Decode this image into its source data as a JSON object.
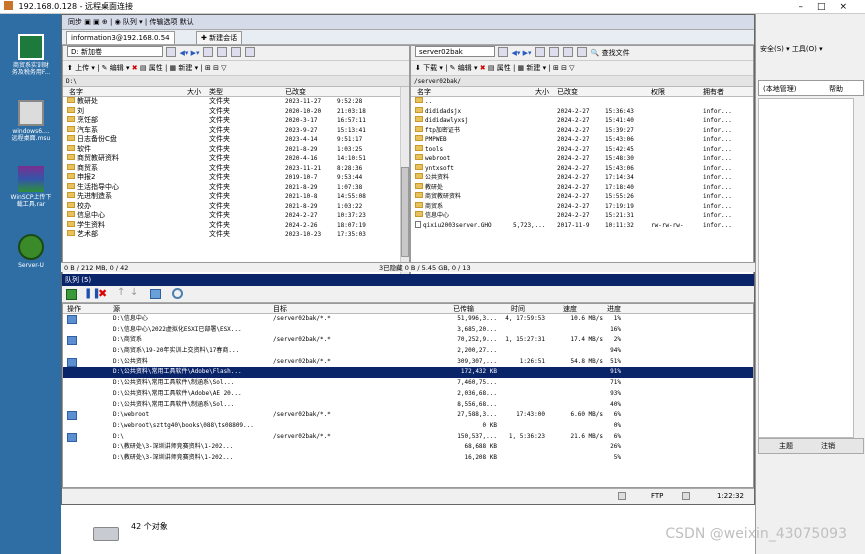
{
  "rdp": {
    "title": "192.168.0.128 - 远程桌面连接"
  },
  "desktop_icons": [
    {
      "label": "商贸系实训财\n务及税务用F..."
    },
    {
      "label": "windows6....\n远程桌面.msu"
    },
    {
      "label": "WinSCP上传下\n载工具.rar"
    },
    {
      "label": "Server-U"
    }
  ],
  "bgwin": {
    "menu": "安全(S) ▾  工具(O) ▾",
    "tab": "(本地管理)",
    "help": "帮助",
    "theme": "主题",
    "logout": "注销"
  },
  "winscp": {
    "toolbar_top": "同步   ▣  ▣  ⊕  | ◉ 队列 ▾ |  传输选项  默认",
    "tabs": [
      {
        "label": "information3@192.168.0.54"
      },
      {
        "label": "新建会话"
      }
    ],
    "left": {
      "drive": "D: 新加卷",
      "upload": "上传",
      "edit": "编辑",
      "props": "属性",
      "new": "新建",
      "path": "D:\\",
      "headers": {
        "name": "名字",
        "size": "大小",
        "type": "类型",
        "modified": "已改变"
      },
      "files": [
        {
          "name": "教研处",
          "type": "文件夹",
          "date": "2023-11-27",
          "time": "9:52:28"
        },
        {
          "name": "刘",
          "type": "文件夹",
          "date": "2020-10-20",
          "time": "21:03:18"
        },
        {
          "name": "烹饪部",
          "type": "文件夹",
          "date": "2020-3-17",
          "time": "16:57:11"
        },
        {
          "name": "汽车系",
          "type": "文件夹",
          "date": "2023-9-27",
          "time": "15:13:41"
        },
        {
          "name": "日志备份C盘",
          "type": "文件夹",
          "date": "2023-4-14",
          "time": "9:51:17"
        },
        {
          "name": "软件",
          "type": "文件夹",
          "date": "2021-8-29",
          "time": "1:03:25"
        },
        {
          "name": "商贸教研资料",
          "type": "文件夹",
          "date": "2020-4-16",
          "time": "14:10:51"
        },
        {
          "name": "商贸系",
          "type": "文件夹",
          "date": "2023-11-21",
          "time": "8:28:36"
        },
        {
          "name": "申报2",
          "type": "文件夹",
          "date": "2019-10-7",
          "time": "9:53:44"
        },
        {
          "name": "生活指导中心",
          "type": "文件夹",
          "date": "2021-8-29",
          "time": "1:07:38"
        },
        {
          "name": "先进制造系",
          "type": "文件夹",
          "date": "2021-10-8",
          "time": "14:55:08"
        },
        {
          "name": "校办",
          "type": "文件夹",
          "date": "2021-8-29",
          "time": "1:03:22"
        },
        {
          "name": "信息中心",
          "type": "文件夹",
          "date": "2024-2-27",
          "time": "10:37:23"
        },
        {
          "name": "学生资料",
          "type": "文件夹",
          "date": "2024-2-26",
          "time": "18:07:19"
        },
        {
          "name": "艺术部",
          "type": "文件夹",
          "date": "2023-10-23",
          "time": "17:35:03"
        }
      ],
      "status": "0 B / 212 MB,  0 / 42"
    },
    "right": {
      "drive": "server02bak",
      "findfiles": "查找文件",
      "download": "下载",
      "edit": "编辑",
      "props": "属性",
      "new": "新建",
      "path": "/server02bak/",
      "headers": {
        "name": "名字",
        "size": "大小",
        "modified": "已改变",
        "perm": "权限",
        "owner": "拥有者"
      },
      "files": [
        {
          "name": "..",
          "size": "",
          "date": "",
          "time": "",
          "perm": "",
          "owner": "",
          "kind": "up"
        },
        {
          "name": "dididadsjx",
          "size": "",
          "date": "2024-2-27",
          "time": "15:36:43",
          "perm": "",
          "owner": "infor...",
          "kind": "folder"
        },
        {
          "name": "dididawlyxsj",
          "size": "",
          "date": "2024-2-27",
          "time": "15:41:40",
          "perm": "",
          "owner": "infor...",
          "kind": "folder"
        },
        {
          "name": "ftp加密证书",
          "size": "",
          "date": "2024-2-27",
          "time": "15:39:27",
          "perm": "",
          "owner": "infor...",
          "kind": "folder"
        },
        {
          "name": "PMPWEB",
          "size": "",
          "date": "2024-2-27",
          "time": "15:43:06",
          "perm": "",
          "owner": "infor...",
          "kind": "folder"
        },
        {
          "name": "tools",
          "size": "",
          "date": "2024-2-27",
          "time": "15:42:45",
          "perm": "",
          "owner": "infor...",
          "kind": "folder"
        },
        {
          "name": "webroot",
          "size": "",
          "date": "2024-2-27",
          "time": "15:48:30",
          "perm": "",
          "owner": "infor...",
          "kind": "folder"
        },
        {
          "name": "yntxsoft",
          "size": "",
          "date": "2024-2-27",
          "time": "15:43:06",
          "perm": "",
          "owner": "infor...",
          "kind": "folder"
        },
        {
          "name": "公共资料",
          "size": "",
          "date": "2024-2-27",
          "time": "17:14:34",
          "perm": "",
          "owner": "infor...",
          "kind": "folder"
        },
        {
          "name": "教研处",
          "size": "",
          "date": "2024-2-27",
          "time": "17:18:40",
          "perm": "",
          "owner": "infor...",
          "kind": "folder"
        },
        {
          "name": "商贸教研资料",
          "size": "",
          "date": "2024-2-27",
          "time": "15:55:26",
          "perm": "",
          "owner": "infor...",
          "kind": "folder"
        },
        {
          "name": "商贸系",
          "size": "",
          "date": "2024-2-27",
          "time": "17:19:19",
          "perm": "",
          "owner": "infor...",
          "kind": "folder"
        },
        {
          "name": "信息中心",
          "size": "",
          "date": "2024-2-27",
          "time": "15:21:31",
          "perm": "",
          "owner": "infor...",
          "kind": "folder"
        },
        {
          "name": "qixiu2003server.GHO",
          "size": "5,723,...",
          "date": "2017-11-9",
          "time": "10:11:32",
          "perm": "rw-rw-rw-",
          "owner": "infor...",
          "kind": "file"
        }
      ],
      "status": "3已隐藏  0 B / 5.45 GB,  0 / 13"
    },
    "queue": {
      "title": "队列 (5)",
      "headers": {
        "op": "操作",
        "src": "源",
        "dst": "目标",
        "transferred": "已传输",
        "time": "时间",
        "speed": "速度",
        "progress": "进度"
      },
      "rows": [
        {
          "src": "D:\\信息中心",
          "dst": "/server02bak/*.*",
          "tx": "51,996,3...",
          "time": "4,  17:59:53",
          "speed": "10.6 MB/s",
          "prog": "1%",
          "icon": true,
          "sel": false
        },
        {
          "src": "D:\\信息中心\\2022虚拟化ESXI已部署\\ESX...",
          "dst": "",
          "tx": "3,685,20...",
          "time": "",
          "speed": "",
          "prog": "16%",
          "icon": false,
          "sel": false
        },
        {
          "src": "D:\\商贸系",
          "dst": "/server02bak/*.*",
          "tx": "70,252,9...",
          "time": "1,  15:27:31",
          "speed": "17.4 MB/s",
          "prog": "2%",
          "icon": true,
          "sel": false
        },
        {
          "src": "D:\\商贸系\\19-20年实训上交资料\\17春商...",
          "dst": "",
          "tx": "2,200,27...",
          "time": "",
          "speed": "",
          "prog": "94%",
          "icon": false,
          "sel": false
        },
        {
          "src": "D:\\公共资料",
          "dst": "/server02bak/*.*",
          "tx": "309,307,...",
          "time": "1:26:51",
          "speed": "54.8 MB/s",
          "prog": "51%",
          "icon": true,
          "sel": false
        },
        {
          "src": "D:\\公共资料\\常用工具软件\\Adobe\\Flash...",
          "dst": "",
          "tx": "172,432 KB",
          "time": "",
          "speed": "",
          "prog": "91%",
          "icon": false,
          "sel": true
        },
        {
          "src": "D:\\公共资料\\常用工具软件\\制涵系\\Sol...",
          "dst": "",
          "tx": "7,460,75...",
          "time": "",
          "speed": "",
          "prog": "71%",
          "icon": false,
          "sel": false
        },
        {
          "src": "D:\\公共资料\\常用工具软件\\Adobe\\AE 20...",
          "dst": "",
          "tx": "2,036,68...",
          "time": "",
          "speed": "",
          "prog": "93%",
          "icon": false,
          "sel": false
        },
        {
          "src": "D:\\公共资料\\常用工具软件\\制涵系\\Sol...",
          "dst": "",
          "tx": "8,556,68...",
          "time": "",
          "speed": "",
          "prog": "40%",
          "icon": false,
          "sel": false
        },
        {
          "src": "D:\\webroot",
          "dst": "/server02bak/*.*",
          "tx": "27,588,3...",
          "time": "17:43:00",
          "speed": "6.60 MB/s",
          "prog": "6%",
          "icon": true,
          "sel": false
        },
        {
          "src": "D:\\webroot\\szttg40\\books\\088\\ts08809...",
          "dst": "",
          "tx": "0 KB",
          "time": "",
          "speed": "",
          "prog": "0%",
          "icon": false,
          "sel": false
        },
        {
          "src": "D:\\",
          "dst": "/server02bak/*.*",
          "tx": "150,537,...",
          "time": "1,  5:36:23",
          "speed": "21.6 MB/s",
          "prog": "6%",
          "icon": true,
          "sel": false
        },
        {
          "src": "D:\\教研处\\3-深圳讲师竞赛资料\\1-202...",
          "dst": "",
          "tx": "68,688 KB",
          "time": "",
          "speed": "",
          "prog": "26%",
          "icon": false,
          "sel": false
        },
        {
          "src": "D:\\教研处\\3-深圳讲师竞赛资料\\1-202...",
          "dst": "",
          "tx": "16,208 KB",
          "time": "",
          "speed": "",
          "prog": "5%",
          "icon": false,
          "sel": false
        }
      ],
      "status_proto": "FTP",
      "status_time": "1:22:32"
    }
  },
  "explorer": {
    "count": "42 个对象"
  },
  "watermark": "CSDN @weixin_43075093"
}
